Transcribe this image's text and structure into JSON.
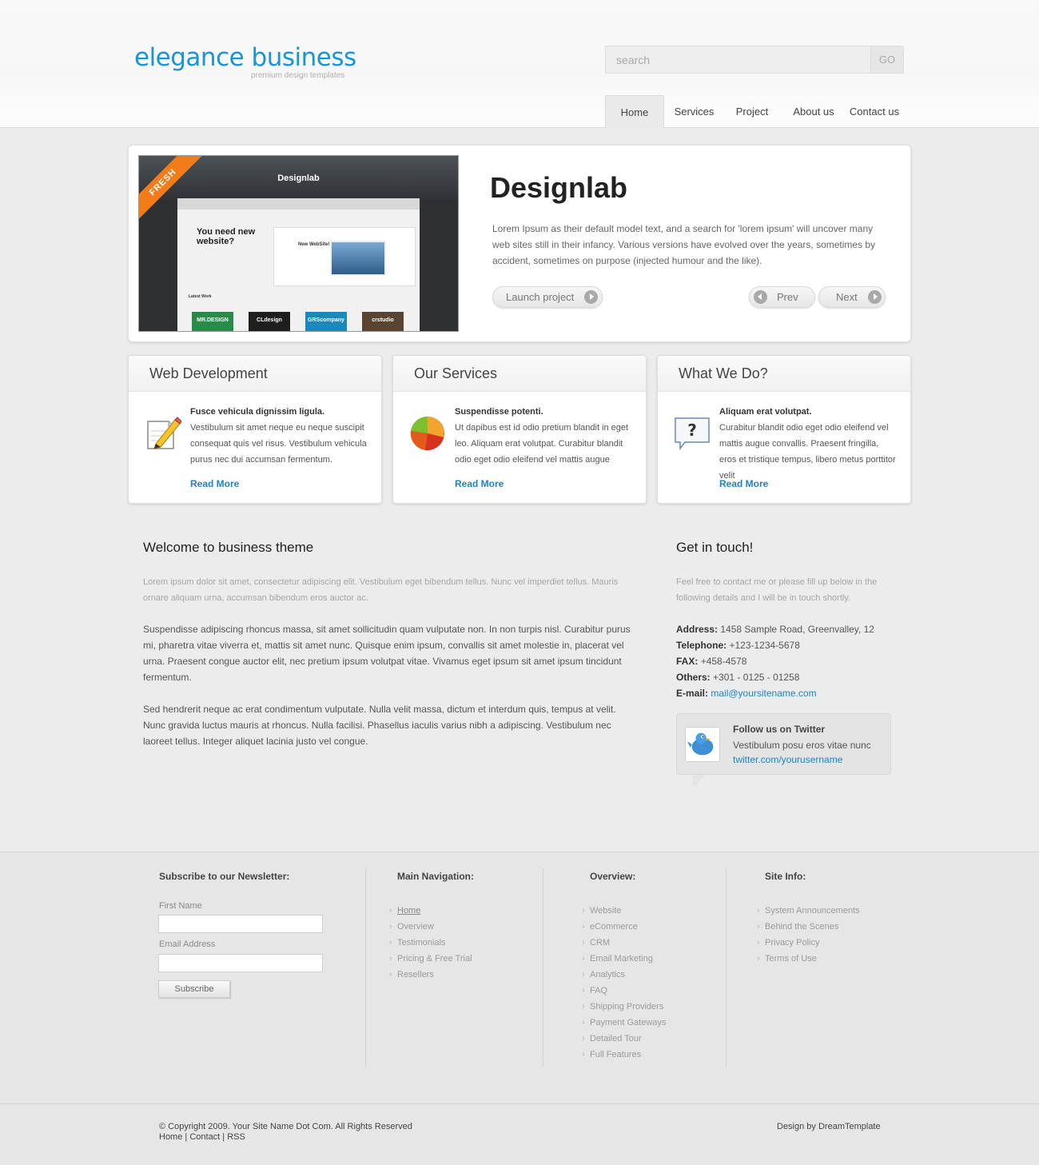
{
  "header": {
    "logo_title": "elegance business",
    "logo_subtitle": "premium design templates",
    "search_placeholder": "search",
    "search_button": "GO",
    "nav": [
      {
        "label": "Home",
        "active": true
      },
      {
        "label": "Services"
      },
      {
        "label": "Project"
      },
      {
        "label": "About us"
      },
      {
        "label": "Contact us"
      }
    ]
  },
  "feature": {
    "ribbon": "FRESH",
    "thumb_title": "Designlab",
    "thumb_heading": "You need new website?",
    "thumb_banner": "New WebSite!",
    "thumb_section": "Latest Work",
    "thumb_tiles": [
      "MR.DESIGN",
      "CLdesign",
      "GRScompany",
      "crstudio"
    ],
    "title": "Designlab",
    "text": "Lorem Ipsum as their default model text, and a search for 'lorem ipsum' will uncover many web sites still in their infancy. Various versions have evolved over the years, sometimes by accident, sometimes on purpose (injected humour and the like).",
    "launch_label": "Launch project",
    "prev_label": "Prev",
    "next_label": "Next"
  },
  "boxes": [
    {
      "title": "Web Development",
      "icon": "pencil-note-icon",
      "subtitle": "Fusce vehicula dignissim ligula.",
      "text": "Vestibulum sit amet neque eu neque suscipit consequat quis vel risus. Vestibulum vehicula purus nec dui accumsan fermentum.",
      "more": "Read More"
    },
    {
      "title": "Our Services",
      "icon": "pie-chart-icon",
      "subtitle": "Suspendisse potenti.",
      "text": "Ut dapibus est id odio pretium blandit in eget leo. Aliquam erat volutpat. Curabitur blandit odio eget odio eleifend vel mattis augue",
      "more": "Read More"
    },
    {
      "title": "What We Do?",
      "icon": "question-bubble-icon",
      "subtitle": "Aliquam erat volutpat.",
      "text": "Curabitur blandit odio eget odio eleifend vel mattis augue convallis. Praesent fringilla, eros et tristique tempus, libero metus porttitor velit",
      "more": "Read More"
    }
  ],
  "welcome": {
    "title": "Welcome to business theme",
    "lead": "Lorem ipsum dolor sit amet, consectetur adipiscing elit. Vestibulum eget bibendum tellus. Nunc vel imperdiet tellus. Mauris ornare aliquam urna, accumsan bibendum eros auctor ac.",
    "p1": "Suspendisse adipiscing rhoncus massa, sit amet sollicitudin quam vulputate non. In non turpis nisl. Curabitur purus mi, pharetra vitae viverra et, mattis sit amet nunc. Quisque enim ipsum, convallis sit amet molestie in, placerat vel urna. Praesent congue auctor elit, nec pretium ipsum volutpat vitae. Vivamus eget ipsum sit amet ipsum tincidunt fermentum.",
    "p2": "Sed hendrerit neque ac erat condimentum vulputate. Nulla velit massa, dictum et interdum quis, tempus at velit. Nunc gravida luctus mauris at rhoncus. Nulla facilisi. Phasellus iaculis varius nibh a adipiscing. Vestibulum nec laoreet tellus. Integer aliquet lacinia justo vel congue."
  },
  "contact": {
    "title": "Get in touch!",
    "lead": "Feel free to contact me or please fill up below in the following details and I will be in touch shortly.",
    "address_label": "Address:",
    "address": "1458 Sample Road, Greenvalley, 12",
    "telephone_label": "Telephone:",
    "telephone": "+123-1234-5678",
    "fax_label": "FAX:",
    "fax": "+458-4578",
    "others_label": "Others:",
    "others": "+301 - 0125 - 01258",
    "email_label": "E-mail:",
    "email": "mail@yoursitename.com",
    "twitter_title": "Follow us on Twitter",
    "twitter_text": "Vestibulum posu eros vitae nunc",
    "twitter_link": "twitter.com/yourusername"
  },
  "footer": {
    "newsletter_title": "Subscribe to our Newsletter:",
    "first_name_label": "First Name",
    "email_label": "Email Address",
    "subscribe_label": "Subscribe",
    "main_nav_title": "Main Navigation:",
    "main_nav": [
      "Home",
      "Overview",
      "Testimonials",
      "Pricing & Free Trial",
      "Resellers"
    ],
    "overview_title": "Overview:",
    "overview": [
      "Website",
      "eCommerce",
      "CRM",
      "Email Marketing",
      "Analytics",
      "FAQ",
      "Shipping Providers",
      "Payment Gateways",
      "Detailed Tour",
      "Full Features"
    ],
    "siteinfo_title": "Site Info:",
    "siteinfo": [
      "System Announcements",
      "Behind the Scenes",
      "Privacy Policy",
      "Terms of Use"
    ],
    "copyright": "© Copyright 2009. Your Site Name Dot Com. All Rights Reserved",
    "bottom_links": [
      "Home",
      "Contact",
      "RSS"
    ],
    "credit": "Design by DreamTemplate"
  },
  "colors": {
    "brand": "#1a94d4",
    "link": "#1a85c5",
    "ribbon": "#f27c1a"
  }
}
